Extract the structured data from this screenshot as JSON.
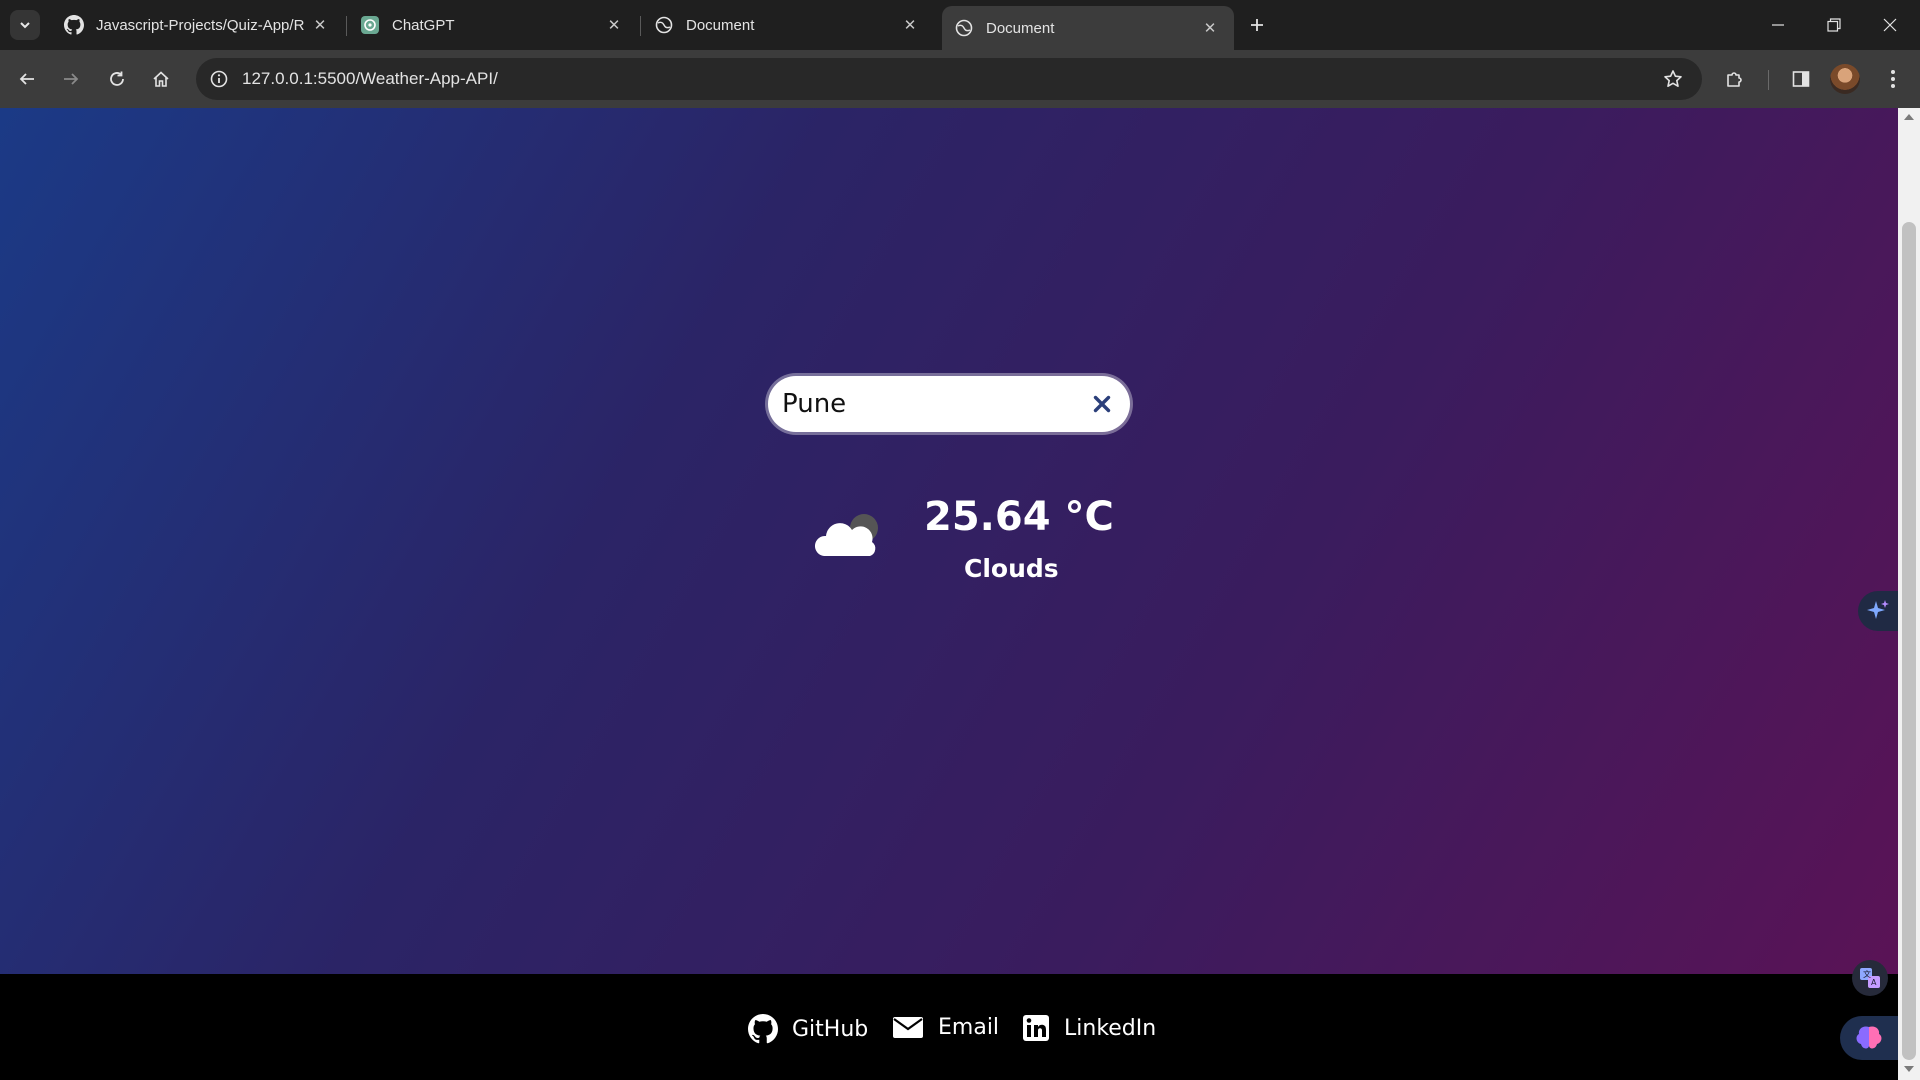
{
  "browser": {
    "tabs": [
      {
        "title": "Javascript-Projects/Quiz-App/R",
        "favicon": "github-icon"
      },
      {
        "title": "ChatGPT",
        "favicon": "chatgpt-icon"
      },
      {
        "title": "Document",
        "favicon": "globe-icon"
      },
      {
        "title": "Document",
        "favicon": "globe-icon",
        "active": true
      }
    ],
    "url": "127.0.0.1:5500/Weather-App-API/"
  },
  "page": {
    "search": {
      "value": "Pune",
      "placeholder": ""
    },
    "weather": {
      "temperature": "25.64 °C",
      "condition": "Clouds",
      "icon": "cloud-icon"
    },
    "footer": {
      "links": [
        {
          "label": "GitHub",
          "icon": "github-icon"
        },
        {
          "label": "Email",
          "icon": "envelope-icon"
        },
        {
          "label": "LinkedIn",
          "icon": "linkedin-icon"
        }
      ]
    },
    "colors": {
      "gradient_start": "#1b3a86",
      "gradient_end": "#5a1356",
      "footer_bg": "#000000",
      "clear_icon": "#2b3f7a"
    }
  }
}
